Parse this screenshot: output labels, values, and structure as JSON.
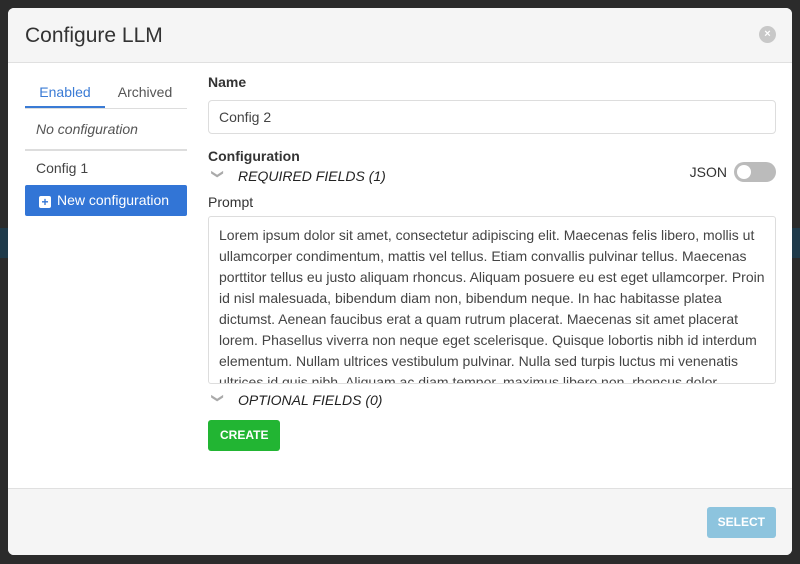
{
  "modal": {
    "title": "Configure LLM",
    "close_icon": "close-icon"
  },
  "sidebar": {
    "tabs": [
      {
        "label": "Enabled",
        "active": true
      },
      {
        "label": "Archived",
        "active": false
      }
    ],
    "empty_label": "No configuration",
    "items": [
      {
        "label": "Config 1"
      }
    ],
    "new_button": "New configuration"
  },
  "form": {
    "name_label": "Name",
    "name_value": "Config 2",
    "config_label": "Configuration",
    "json_label": "JSON",
    "json_enabled": false,
    "required_label": "REQUIRED FIELDS (1)",
    "prompt_label": "Prompt",
    "prompt_value": "Lorem ipsum dolor sit amet, consectetur adipiscing elit. Maecenas felis libero, mollis ut ullamcorper condimentum, mattis vel tellus. Etiam convallis pulvinar tellus. Maecenas porttitor tellus eu justo aliquam rhoncus. Aliquam posuere eu est eget ullamcorper. Proin id nisl malesuada, bibendum diam non, bibendum neque. In hac habitasse platea dictumst. Aenean faucibus erat a quam rutrum placerat. Maecenas sit amet placerat lorem. Phasellus viverra non neque eget scelerisque. Quisque lobortis nibh id interdum elementum. Nullam ultrices vestibulum pulvinar. Nulla sed turpis luctus mi venenatis ultrices id quis nibh. Aliquam ac diam tempor, maximus libero non, rhoncus dolor.",
    "optional_label": "OPTIONAL FIELDS (0)",
    "create_button": "CREATE"
  },
  "footer": {
    "select_button": "SELECT"
  }
}
